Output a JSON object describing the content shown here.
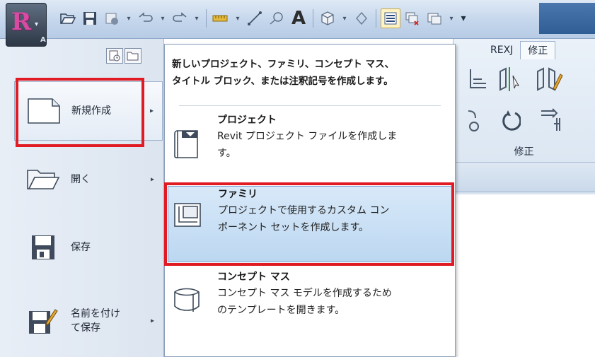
{
  "app": {
    "logo_letter": "R",
    "menu_badge": "A",
    "brand_color": "#d94aa2"
  },
  "quick_access": {
    "icons": [
      "open-icon",
      "save-icon",
      "sync-icon",
      "undo-icon",
      "redo-icon",
      "measure-icon",
      "dimension-icon",
      "tag-icon",
      "text-icon",
      "3d-view-icon",
      "section-icon",
      "thin-lines-icon",
      "close-hidden-icon",
      "switch-windows-icon",
      "customize-icon"
    ],
    "text_tool_label": "A"
  },
  "ribbon": {
    "tabs": [
      "REXJ",
      "修正"
    ],
    "active_tab": "修正",
    "panel_label": "修正"
  },
  "left_menu": {
    "items": [
      {
        "label": "新規作成",
        "has_submenu": true,
        "icon": "new-document-icon"
      },
      {
        "label": "開く",
        "has_submenu": true,
        "icon": "open-folder-icon"
      },
      {
        "label": "保存",
        "has_submenu": false,
        "icon": "save-disk-icon"
      },
      {
        "label_line1": "名前を付け",
        "label_line2": "て保存",
        "has_submenu": true,
        "icon": "save-as-icon"
      }
    ],
    "submenu_arrow": "▸"
  },
  "submenu": {
    "header_line1": "新しいプロジェクト、ファミリ、コンセプト マス、",
    "header_line2": "タイトル ブロック、または注釈記号を作成します。",
    "items": [
      {
        "title": "プロジェクト",
        "desc_line1": "Revit プロジェクト ファイルを作成しま",
        "desc_line2": "す。",
        "icon": "project-icon"
      },
      {
        "title": "ファミリ",
        "desc_line1": "プロジェクトで使用するカスタム コン",
        "desc_line2": "ポーネント セットを作成します。",
        "icon": "family-icon"
      },
      {
        "title": "コンセプト マス",
        "desc_line1": "コンセプト マス モデルを作成するため",
        "desc_line2": "のテンプレートを開きます。",
        "icon": "conceptual-mass-icon"
      }
    ]
  },
  "colors": {
    "highlight_border": "#e01b23",
    "hover_fill": "#bcd7f1"
  }
}
